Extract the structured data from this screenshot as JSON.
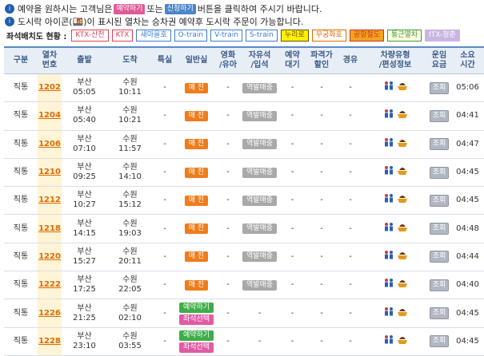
{
  "notices": {
    "line1_pre": "예약을 원하시는 고객님은",
    "line1_btn1": "예약하기",
    "line1_mid": "또는",
    "line1_btn2": "신청하기",
    "line1_post": "버튼을 클릭하여 주시기 바랍니다.",
    "line2": "도시락 아이콘(🍱)이 표시된 열차는 승차권 예약후 도시락 주문이 가능합니다."
  },
  "legend": {
    "label": "좌석배치도 현황 :",
    "items": [
      {
        "text": "KTX-산천",
        "color": "#e0405a",
        "bg": "#ffffff"
      },
      {
        "text": "KTX",
        "color": "#e0405a",
        "bg": "#ffffff"
      },
      {
        "text": "새마을호",
        "color": "#3a7bd5",
        "bg": "#ffffff"
      },
      {
        "text": "O-train",
        "color": "#3a7bd5",
        "bg": "#ffffff"
      },
      {
        "text": "V-train",
        "color": "#3a7bd5",
        "bg": "#ffffff"
      },
      {
        "text": "S-train",
        "color": "#3a7bd5",
        "bg": "#ffffff"
      },
      {
        "text": "누리로",
        "color": "#6b4e00",
        "bg": "#fff200"
      },
      {
        "text": "무궁화호",
        "color": "#e06a00",
        "bg": "#ffffff"
      },
      {
        "text": "공항철도",
        "color": "#c0392b",
        "bg": "#f5a31a"
      },
      {
        "text": "통근열차",
        "color": "#3a9a3a",
        "bg": "#fffde0"
      },
      {
        "text": "ITX-청춘",
        "color": "#ffffff",
        "bg": "#c8b6e2"
      }
    ]
  },
  "headers": [
    "구분",
    "열차\n번호",
    "출발",
    "도착",
    "특실",
    "일반실",
    "영화\n/유아",
    "자유석\n/입석",
    "예약\n대기",
    "파격가\n할인",
    "경유",
    "차량유형\n/편성정보",
    "운임\n요금",
    "소요\n시간"
  ],
  "rows": [
    {
      "type": "직통",
      "no": "1202",
      "dep_st": "부산",
      "dep_t": "05:05",
      "arr_st": "수원",
      "arr_t": "10:11",
      "first": "-",
      "general": "매 진",
      "general_kind": "sell",
      "movie": "-",
      "free": "역발매중",
      "wait": "-",
      "disc": "-",
      "via": "-",
      "fare": "조회",
      "dur": "05:06"
    },
    {
      "type": "직통",
      "no": "1204",
      "dep_st": "부산",
      "dep_t": "05:40",
      "arr_st": "수원",
      "arr_t": "10:21",
      "first": "-",
      "general": "매 진",
      "general_kind": "sell",
      "movie": "-",
      "free": "역발매중",
      "wait": "-",
      "disc": "-",
      "via": "-",
      "fare": "조회",
      "dur": "04:41"
    },
    {
      "type": "직통",
      "no": "1206",
      "dep_st": "부산",
      "dep_t": "07:10",
      "arr_st": "수원",
      "arr_t": "11:57",
      "first": "-",
      "general": "매 진",
      "general_kind": "sell",
      "movie": "-",
      "free": "역발매중",
      "wait": "-",
      "disc": "-",
      "via": "-",
      "fare": "조회",
      "dur": "04:47"
    },
    {
      "type": "직통",
      "no": "1210",
      "dep_st": "부산",
      "dep_t": "09:25",
      "arr_st": "수원",
      "arr_t": "14:10",
      "first": "-",
      "general": "매 진",
      "general_kind": "sell",
      "movie": "-",
      "free": "역발매중",
      "wait": "-",
      "disc": "-",
      "via": "-",
      "fare": "조회",
      "dur": "04:45"
    },
    {
      "type": "직통",
      "no": "1212",
      "dep_st": "부산",
      "dep_t": "10:27",
      "arr_st": "수원",
      "arr_t": "15:12",
      "first": "-",
      "general": "매 진",
      "general_kind": "sell",
      "movie": "-",
      "free": "역발매중",
      "wait": "-",
      "disc": "-",
      "via": "-",
      "fare": "조회",
      "dur": "04:45"
    },
    {
      "type": "직통",
      "no": "1218",
      "dep_st": "부산",
      "dep_t": "14:15",
      "arr_st": "수원",
      "arr_t": "19:03",
      "first": "-",
      "general": "매 진",
      "general_kind": "sell",
      "movie": "-",
      "free": "역발매중",
      "wait": "-",
      "disc": "-",
      "via": "-",
      "fare": "조회",
      "dur": "04:48"
    },
    {
      "type": "직통",
      "no": "1220",
      "dep_st": "부산",
      "dep_t": "15:27",
      "arr_st": "수원",
      "arr_t": "20:11",
      "first": "-",
      "general": "매 진",
      "general_kind": "sell",
      "movie": "-",
      "free": "역발매중",
      "wait": "-",
      "disc": "-",
      "via": "-",
      "fare": "조회",
      "dur": "04:44"
    },
    {
      "type": "직통",
      "no": "1222",
      "dep_st": "부산",
      "dep_t": "17:25",
      "arr_st": "수원",
      "arr_t": "22:05",
      "first": "-",
      "general": "매 진",
      "general_kind": "sell",
      "movie": "-",
      "free": "역발매중",
      "wait": "-",
      "disc": "-",
      "via": "-",
      "fare": "조회",
      "dur": "04:40"
    },
    {
      "type": "직통",
      "no": "1226",
      "dep_st": "부산",
      "dep_t": "21:25",
      "arr_st": "수원",
      "arr_t": "02:10",
      "first": "-",
      "general": "예약하기",
      "general2": "좌석선택",
      "general_kind": "resv",
      "movie": "-",
      "free": "-",
      "wait": "-",
      "disc": "-",
      "via": "-",
      "fare": "조회",
      "dur": "04:45"
    },
    {
      "type": "직통",
      "no": "1228",
      "dep_st": "부산",
      "dep_t": "23:10",
      "arr_st": "수원",
      "arr_t": "03:55",
      "first": "-",
      "general": "예약하기",
      "general2": "좌석선택",
      "general_kind": "resv",
      "movie": "-",
      "free": "-",
      "wait": "-",
      "disc": "-",
      "via": "-",
      "fare": "조회",
      "dur": "04:45"
    }
  ]
}
